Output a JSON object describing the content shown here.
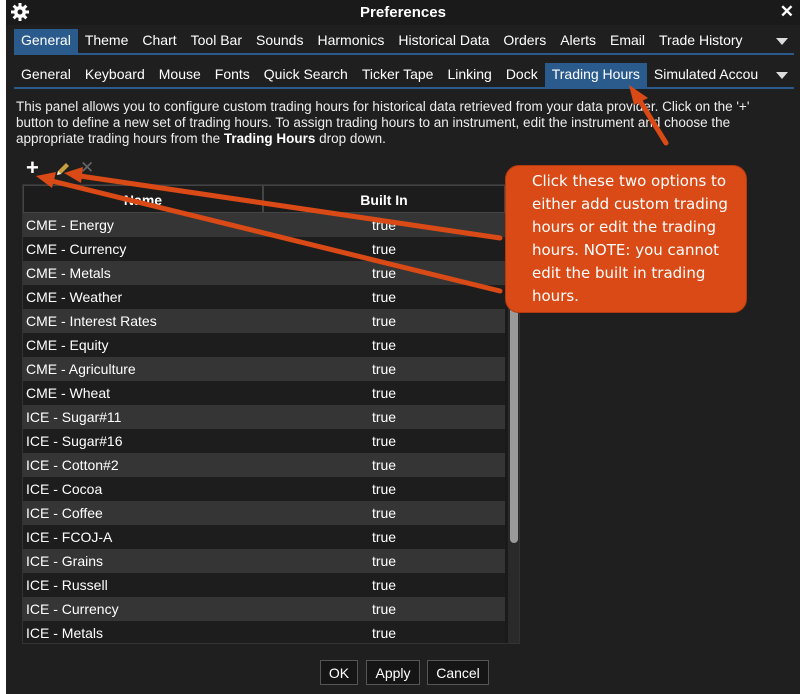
{
  "window": {
    "title": "Preferences"
  },
  "main_tabs": [
    "General",
    "Theme",
    "Chart",
    "Tool Bar",
    "Sounds",
    "Harmonics",
    "Historical Data",
    "Orders",
    "Alerts",
    "Email",
    "Trade History"
  ],
  "main_tab_active": "General",
  "sub_tabs": [
    "General",
    "Keyboard",
    "Mouse",
    "Fonts",
    "Quick Search",
    "Ticker Tape",
    "Linking",
    "Dock",
    "Trading Hours",
    "Simulated Accou"
  ],
  "sub_tab_active": "Trading Hours",
  "description": {
    "part1": "This panel allows you to configure custom trading hours for historical data retrieved from your data provider.  Click on the '+' button to define a new set of trading hours.  To assign trading hours to an instrument, edit the instrument and choose the appropriate trading hours from the ",
    "bold": "Trading Hours",
    "part2": " drop down."
  },
  "toolbar": {
    "add": "+",
    "remove": "✕"
  },
  "table": {
    "columns": [
      "Name",
      "Built In"
    ],
    "rows": [
      [
        "CME - Energy",
        "true"
      ],
      [
        "CME - Currency",
        "true"
      ],
      [
        "CME - Metals",
        "true"
      ],
      [
        "CME - Weather",
        "true"
      ],
      [
        "CME - Interest Rates",
        "true"
      ],
      [
        "CME - Equity",
        "true"
      ],
      [
        "CME - Agriculture",
        "true"
      ],
      [
        "CME - Wheat",
        "true"
      ],
      [
        "ICE - Sugar#11",
        "true"
      ],
      [
        "ICE - Sugar#16",
        "true"
      ],
      [
        "ICE - Cotton#2",
        "true"
      ],
      [
        "ICE - Cocoa",
        "true"
      ],
      [
        "ICE - Coffee",
        "true"
      ],
      [
        "ICE - FCOJ-A",
        "true"
      ],
      [
        "ICE - Grains",
        "true"
      ],
      [
        "ICE - Russell",
        "true"
      ],
      [
        "ICE - Currency",
        "true"
      ],
      [
        "ICE - Metals",
        "true"
      ]
    ]
  },
  "buttons": {
    "ok": "OK",
    "apply": "Apply",
    "cancel": "Cancel"
  },
  "callout": {
    "text": "Click these two options to either add custom trading hours or edit the trading hours. NOTE: you cannot edit the built in trading hours."
  },
  "colors": {
    "accent": "#2b5b8d",
    "callout": "#d94a16",
    "background": "#1f1f1f"
  }
}
